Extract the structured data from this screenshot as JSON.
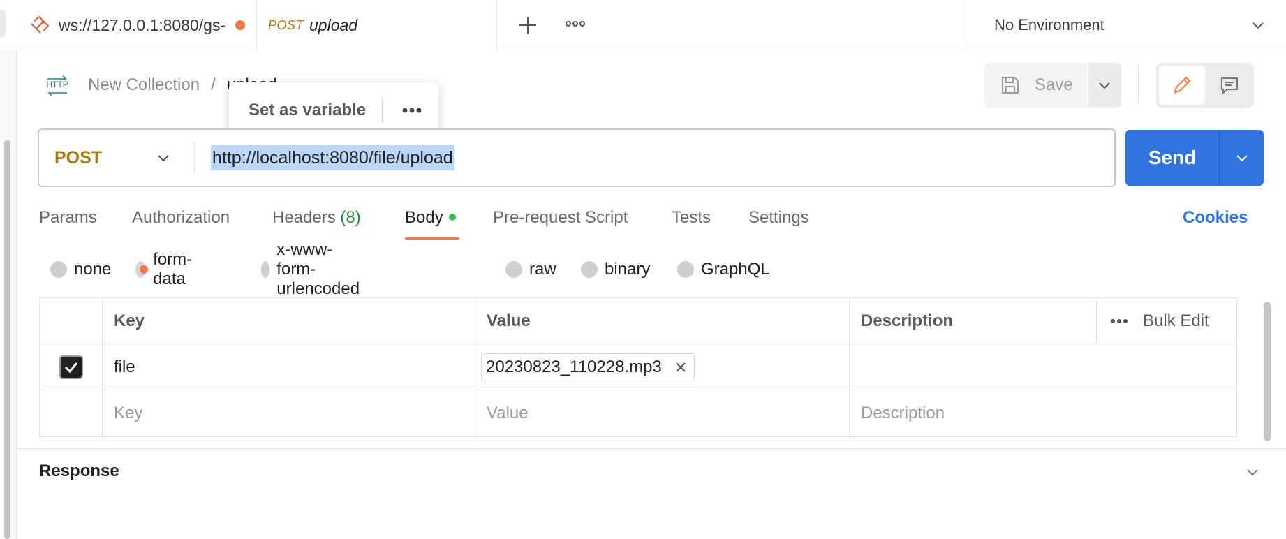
{
  "tabs": [
    {
      "label": "ws://127.0.0.1:8080/gs-",
      "unsaved": true
    },
    {
      "method": "POST",
      "label": "upload"
    }
  ],
  "environment": {
    "label": "No Environment"
  },
  "breadcrumb": {
    "icon": "HTTP",
    "collection": "New Collection",
    "separator": "/",
    "request": "upload"
  },
  "popover": {
    "label": "Set as variable"
  },
  "toolbar": {
    "save_label": "Save"
  },
  "request": {
    "method": "POST",
    "url": "http://localhost:8080/file/upload",
    "send_label": "Send"
  },
  "request_tabs": {
    "params": "Params",
    "authorization": "Authorization",
    "headers": "Headers",
    "headers_count": "(8)",
    "body": "Body",
    "prerequest": "Pre-request Script",
    "tests": "Tests",
    "settings": "Settings",
    "cookies": "Cookies"
  },
  "body_modes": [
    {
      "label": "none",
      "selected": false
    },
    {
      "label": "form-data",
      "selected": true
    },
    {
      "label": "x-www-form-urlencoded",
      "selected": false
    },
    {
      "label": "raw",
      "selected": false
    },
    {
      "label": "binary",
      "selected": false
    },
    {
      "label": "GraphQL",
      "selected": false
    }
  ],
  "form_table": {
    "headers": {
      "key": "Key",
      "value": "Value",
      "description": "Description",
      "bulk_edit": "Bulk Edit"
    },
    "rows": [
      {
        "checked": true,
        "key": "file",
        "value": "20230823_110228.mp3",
        "description": ""
      }
    ],
    "placeholders": {
      "key": "Key",
      "value": "Value",
      "description": "Description"
    }
  },
  "response": {
    "title": "Response"
  },
  "colors": {
    "accent": "#2f74e0",
    "method": "#a87d16",
    "active_tab": "#ef7a45",
    "selection": "#bcd6f7"
  }
}
